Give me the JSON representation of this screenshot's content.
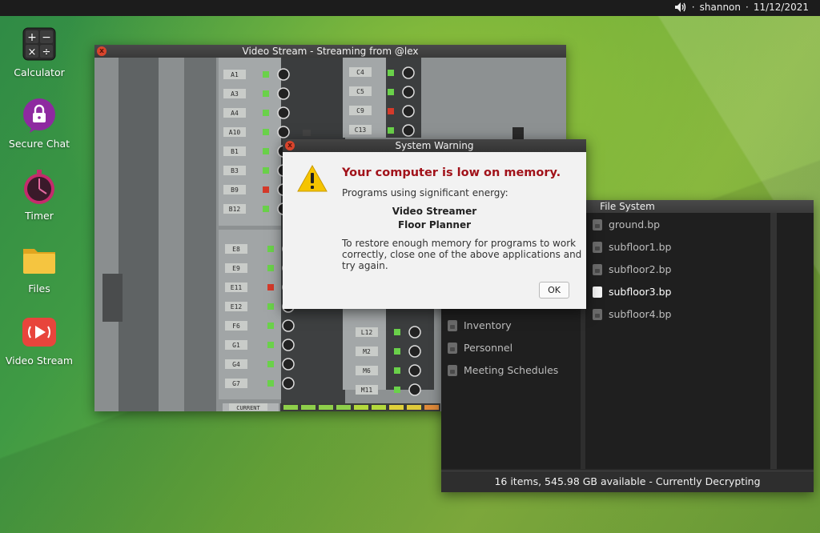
{
  "topbar": {
    "user": "shannon",
    "date": "11/12/2021",
    "separator": "·"
  },
  "desktop": [
    {
      "label": "Calculator",
      "icon": "calculator-icon"
    },
    {
      "label": "Secure Chat",
      "icon": "secure-chat-icon"
    },
    {
      "label": "Timer",
      "icon": "timer-icon"
    },
    {
      "label": "Files",
      "icon": "folder-icon"
    },
    {
      "label": "Video Stream",
      "icon": "video-stream-icon"
    }
  ],
  "video_window": {
    "title": "Video Stream - Streaming from @lex",
    "close": "x",
    "panel_labels_left": [
      "A1",
      "A3",
      "A4",
      "A10",
      "B1",
      "B3",
      "B9",
      "B12"
    ],
    "panel_labels_left2": [
      "E8",
      "E9",
      "E11",
      "E12",
      "F6",
      "G1",
      "G4",
      "G7"
    ],
    "panel_labels_right": [
      "C4",
      "C5",
      "C9",
      "C13"
    ],
    "panel_labels_right2": [
      "L12",
      "M2",
      "M6",
      "M11"
    ],
    "meter_label": "CURRENT"
  },
  "fs_window": {
    "title": "File System",
    "folders": [
      "Inventory",
      "Personnel",
      "Meeting Schedules"
    ],
    "files": [
      "ground.bp",
      "subfloor1.bp",
      "subfloor2.bp",
      "subfloor3.bp",
      "subfloor4.bp"
    ],
    "selected_file": "subfloor3.bp",
    "status": "16 items, 545.98 GB available - Currently Decrypting"
  },
  "dialog": {
    "title": "System Warning",
    "close": "x",
    "heading": "Your computer is low on memory.",
    "intro": "Programs using significant energy:",
    "apps": [
      "Video Streamer",
      "Floor Planner"
    ],
    "body_lines": [
      "To restore enough memory for programs to work",
      "correctly, close one of the above applications and",
      "try again."
    ],
    "ok_label": "OK"
  },
  "colors": {
    "warning_red": "#a1121a",
    "warning_yellow": "#f5c400",
    "desktop_green": "#6aab3b"
  }
}
